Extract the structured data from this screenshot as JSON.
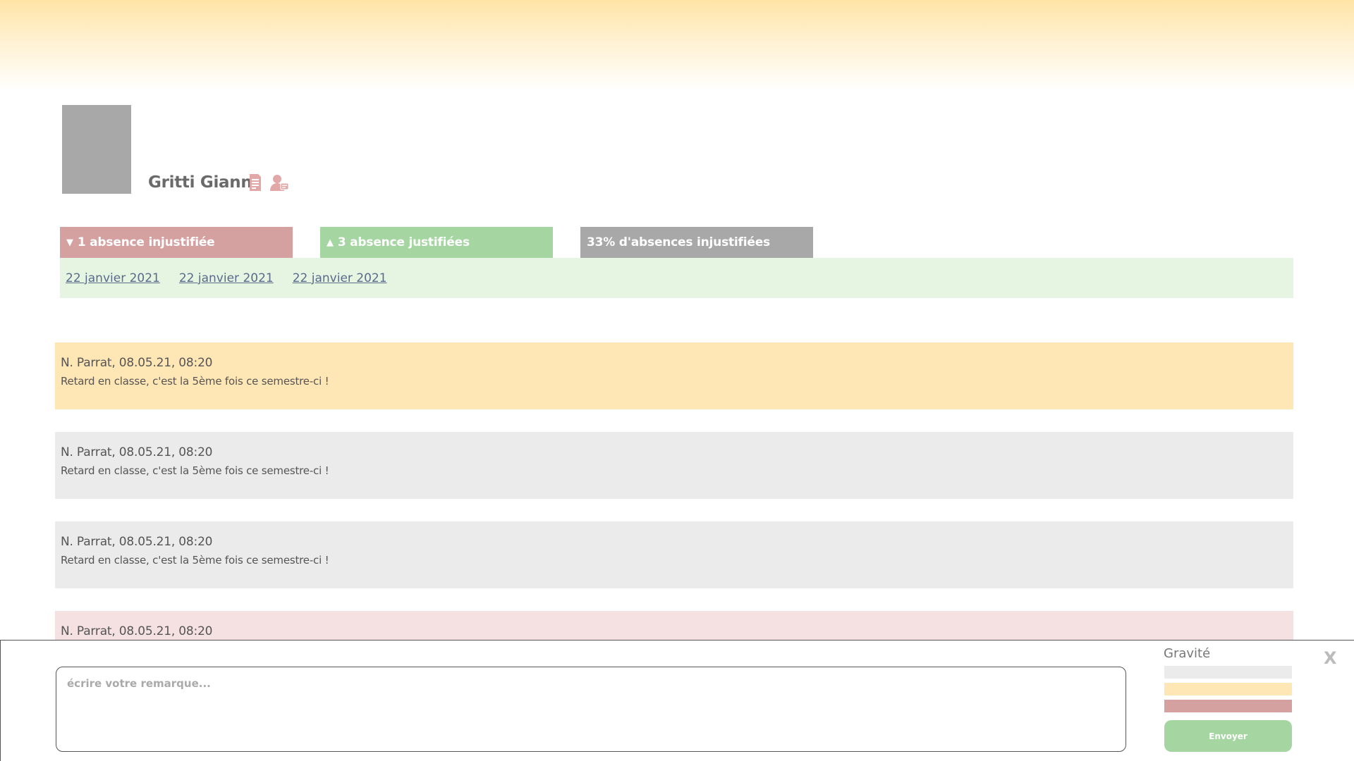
{
  "student": {
    "name": "Gritti Gianni"
  },
  "icons": {
    "report": "document-icon",
    "contact": "user-message-icon"
  },
  "colors": {
    "unjustified": "#d4a0a0",
    "justified": "#a5d6a2",
    "neutral": "#a8a8a8",
    "remark_warning": "#ffe6b5",
    "remark_neutral": "#ebebeb",
    "remark_danger": "#f5e1e1"
  },
  "absences": {
    "unjustified_arrow": "▼",
    "unjustified_label": "1 absence injustifiée",
    "justified_arrow": "▲",
    "justified_label": "3 absence justifiées",
    "ratio_label": "33% d'absences injustifiées",
    "dates": [
      "22 janvier 2021",
      "22 janvier 2021",
      "22 janvier 2021"
    ]
  },
  "remarks": [
    {
      "meta": "N. Parrat, 08.05.21, 08:20",
      "text": "Retard en classe, c'est la 5ème fois ce semestre-ci !",
      "color": "#ffe6b5"
    },
    {
      "meta": "N. Parrat, 08.05.21, 08:20",
      "text": "Retard en classe, c'est la 5ème fois ce semestre-ci !",
      "color": "#ebebeb"
    },
    {
      "meta": "N. Parrat, 08.05.21, 08:20",
      "text": "Retard en classe, c'est la 5ème fois ce semestre-ci !",
      "color": "#ebebeb"
    },
    {
      "meta": "N. Parrat, 08.05.21, 08:20",
      "text": "",
      "color": "#f5e1e1"
    }
  ],
  "composer": {
    "placeholder": "écrire votre remarque...",
    "severity_title": "Gravité",
    "severity_options": [
      "#ebebeb",
      "#ffe6b5",
      "#d4a0a0"
    ],
    "send_label": "Envoyer",
    "close_label": "X"
  }
}
